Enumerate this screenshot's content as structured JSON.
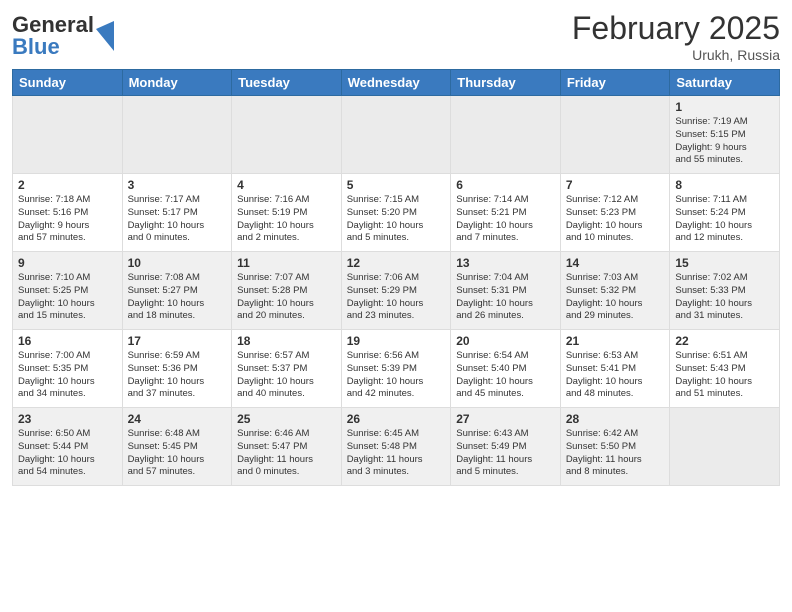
{
  "header": {
    "logo": {
      "general": "General",
      "blue": "Blue"
    },
    "title": "February 2025",
    "subtitle": "Urukh, Russia"
  },
  "weekdays": [
    "Sunday",
    "Monday",
    "Tuesday",
    "Wednesday",
    "Thursday",
    "Friday",
    "Saturday"
  ],
  "weeks": [
    [
      {
        "day": "",
        "info": ""
      },
      {
        "day": "",
        "info": ""
      },
      {
        "day": "",
        "info": ""
      },
      {
        "day": "",
        "info": ""
      },
      {
        "day": "",
        "info": ""
      },
      {
        "day": "",
        "info": ""
      },
      {
        "day": "1",
        "info": "Sunrise: 7:19 AM\nSunset: 5:15 PM\nDaylight: 9 hours\nand 55 minutes."
      }
    ],
    [
      {
        "day": "2",
        "info": "Sunrise: 7:18 AM\nSunset: 5:16 PM\nDaylight: 9 hours\nand 57 minutes."
      },
      {
        "day": "3",
        "info": "Sunrise: 7:17 AM\nSunset: 5:17 PM\nDaylight: 10 hours\nand 0 minutes."
      },
      {
        "day": "4",
        "info": "Sunrise: 7:16 AM\nSunset: 5:19 PM\nDaylight: 10 hours\nand 2 minutes."
      },
      {
        "day": "5",
        "info": "Sunrise: 7:15 AM\nSunset: 5:20 PM\nDaylight: 10 hours\nand 5 minutes."
      },
      {
        "day": "6",
        "info": "Sunrise: 7:14 AM\nSunset: 5:21 PM\nDaylight: 10 hours\nand 7 minutes."
      },
      {
        "day": "7",
        "info": "Sunrise: 7:12 AM\nSunset: 5:23 PM\nDaylight: 10 hours\nand 10 minutes."
      },
      {
        "day": "8",
        "info": "Sunrise: 7:11 AM\nSunset: 5:24 PM\nDaylight: 10 hours\nand 12 minutes."
      }
    ],
    [
      {
        "day": "9",
        "info": "Sunrise: 7:10 AM\nSunset: 5:25 PM\nDaylight: 10 hours\nand 15 minutes."
      },
      {
        "day": "10",
        "info": "Sunrise: 7:08 AM\nSunset: 5:27 PM\nDaylight: 10 hours\nand 18 minutes."
      },
      {
        "day": "11",
        "info": "Sunrise: 7:07 AM\nSunset: 5:28 PM\nDaylight: 10 hours\nand 20 minutes."
      },
      {
        "day": "12",
        "info": "Sunrise: 7:06 AM\nSunset: 5:29 PM\nDaylight: 10 hours\nand 23 minutes."
      },
      {
        "day": "13",
        "info": "Sunrise: 7:04 AM\nSunset: 5:31 PM\nDaylight: 10 hours\nand 26 minutes."
      },
      {
        "day": "14",
        "info": "Sunrise: 7:03 AM\nSunset: 5:32 PM\nDaylight: 10 hours\nand 29 minutes."
      },
      {
        "day": "15",
        "info": "Sunrise: 7:02 AM\nSunset: 5:33 PM\nDaylight: 10 hours\nand 31 minutes."
      }
    ],
    [
      {
        "day": "16",
        "info": "Sunrise: 7:00 AM\nSunset: 5:35 PM\nDaylight: 10 hours\nand 34 minutes."
      },
      {
        "day": "17",
        "info": "Sunrise: 6:59 AM\nSunset: 5:36 PM\nDaylight: 10 hours\nand 37 minutes."
      },
      {
        "day": "18",
        "info": "Sunrise: 6:57 AM\nSunset: 5:37 PM\nDaylight: 10 hours\nand 40 minutes."
      },
      {
        "day": "19",
        "info": "Sunrise: 6:56 AM\nSunset: 5:39 PM\nDaylight: 10 hours\nand 42 minutes."
      },
      {
        "day": "20",
        "info": "Sunrise: 6:54 AM\nSunset: 5:40 PM\nDaylight: 10 hours\nand 45 minutes."
      },
      {
        "day": "21",
        "info": "Sunrise: 6:53 AM\nSunset: 5:41 PM\nDaylight: 10 hours\nand 48 minutes."
      },
      {
        "day": "22",
        "info": "Sunrise: 6:51 AM\nSunset: 5:43 PM\nDaylight: 10 hours\nand 51 minutes."
      }
    ],
    [
      {
        "day": "23",
        "info": "Sunrise: 6:50 AM\nSunset: 5:44 PM\nDaylight: 10 hours\nand 54 minutes."
      },
      {
        "day": "24",
        "info": "Sunrise: 6:48 AM\nSunset: 5:45 PM\nDaylight: 10 hours\nand 57 minutes."
      },
      {
        "day": "25",
        "info": "Sunrise: 6:46 AM\nSunset: 5:47 PM\nDaylight: 11 hours\nand 0 minutes."
      },
      {
        "day": "26",
        "info": "Sunrise: 6:45 AM\nSunset: 5:48 PM\nDaylight: 11 hours\nand 3 minutes."
      },
      {
        "day": "27",
        "info": "Sunrise: 6:43 AM\nSunset: 5:49 PM\nDaylight: 11 hours\nand 5 minutes."
      },
      {
        "day": "28",
        "info": "Sunrise: 6:42 AM\nSunset: 5:50 PM\nDaylight: 11 hours\nand 8 minutes."
      },
      {
        "day": "",
        "info": ""
      }
    ]
  ]
}
